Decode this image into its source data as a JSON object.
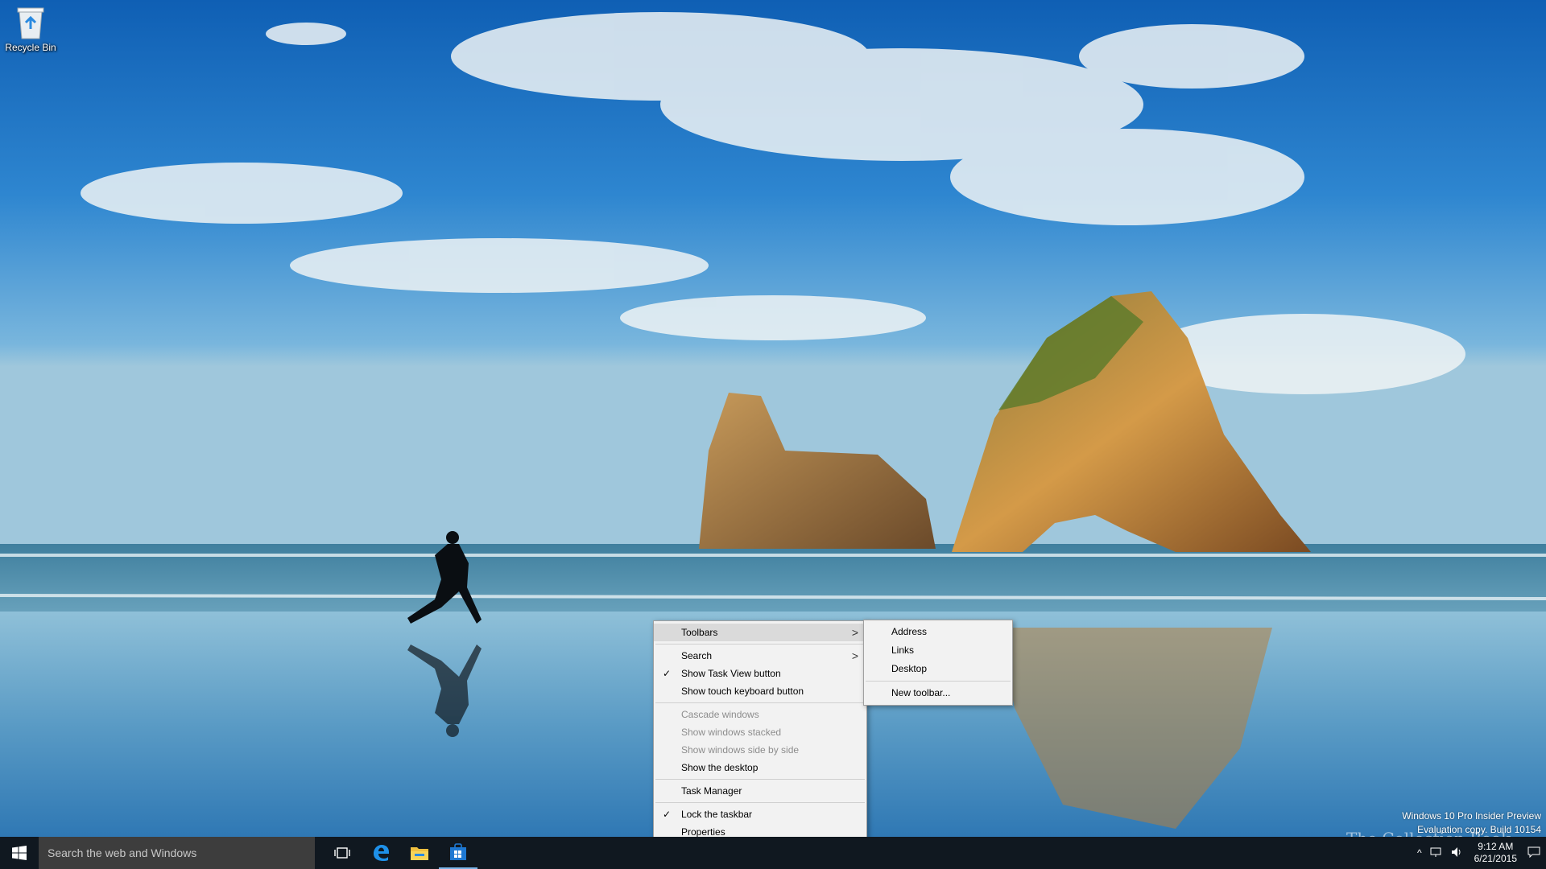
{
  "desktop": {
    "recycle_bin_label": "Recycle Bin"
  },
  "context_menu": {
    "items": [
      {
        "label": "Toolbars"
      },
      {
        "label": "Search"
      },
      {
        "label": "Show Task View button"
      },
      {
        "label": "Show touch keyboard button"
      },
      {
        "label": "Cascade windows"
      },
      {
        "label": "Show windows stacked"
      },
      {
        "label": "Show windows side by side"
      },
      {
        "label": "Show the desktop"
      },
      {
        "label": "Task Manager"
      },
      {
        "label": "Lock the taskbar"
      },
      {
        "label": "Properties"
      }
    ],
    "check_mark": "✓",
    "submenu_arrow": ">"
  },
  "toolbars_submenu": {
    "items": [
      {
        "label": "Address"
      },
      {
        "label": "Links"
      },
      {
        "label": "Desktop"
      },
      {
        "label": "New toolbar..."
      }
    ]
  },
  "watermark": {
    "line1": "Windows 10 Pro Insider Preview",
    "line2": "Evaluation copy. Build 10154"
  },
  "brand_overlay": "The Collection Book",
  "taskbar": {
    "search_placeholder": "Search the web and Windows",
    "pinned": [
      "task-view-icon",
      "edge-icon",
      "file-explorer-icon",
      "store-icon"
    ],
    "clock_time": "9:12 AM",
    "clock_date": "6/21/2015"
  },
  "colors": {
    "taskbar": "#101820",
    "search_box": "#3d3d3d",
    "menu_bg": "#f2f2f2",
    "menu_highlight": "#dadada",
    "edge_blue": "#1e90e8",
    "store_blue": "#1e78d2"
  }
}
